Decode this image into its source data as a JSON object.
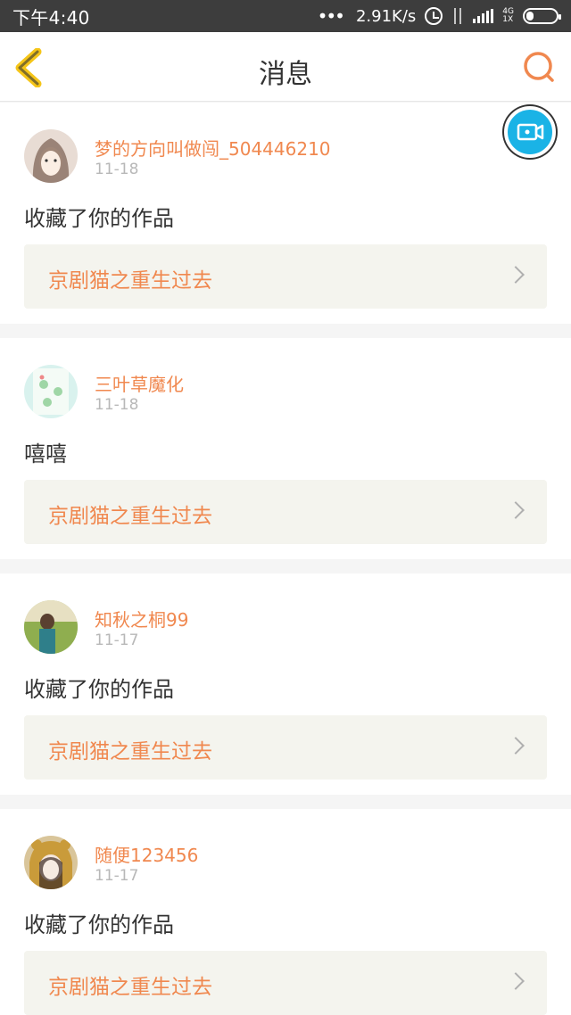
{
  "status_bar": {
    "time": "下午4:40",
    "net_speed": "2.91K/s",
    "net_top": "4G",
    "net_bottom": "1X"
  },
  "nav": {
    "title": "消息",
    "accent_color": "#f0884f",
    "back_color": "#f5c518"
  },
  "messages": [
    {
      "username": "梦的方向叫做闯_504446210",
      "date": "11-18",
      "action": "收藏了你的作品",
      "work_title": "京剧猫之重生过去"
    },
    {
      "username": "三叶草魔化",
      "date": "11-18",
      "action": "嘻嘻",
      "work_title": "京剧猫之重生过去"
    },
    {
      "username": "知秋之桐99",
      "date": "11-17",
      "action": "收藏了你的作品",
      "work_title": "京剧猫之重生过去"
    },
    {
      "username": "随便123456",
      "date": "11-17",
      "action": "收藏了你的作品",
      "work_title": "京剧猫之重生过去"
    }
  ]
}
